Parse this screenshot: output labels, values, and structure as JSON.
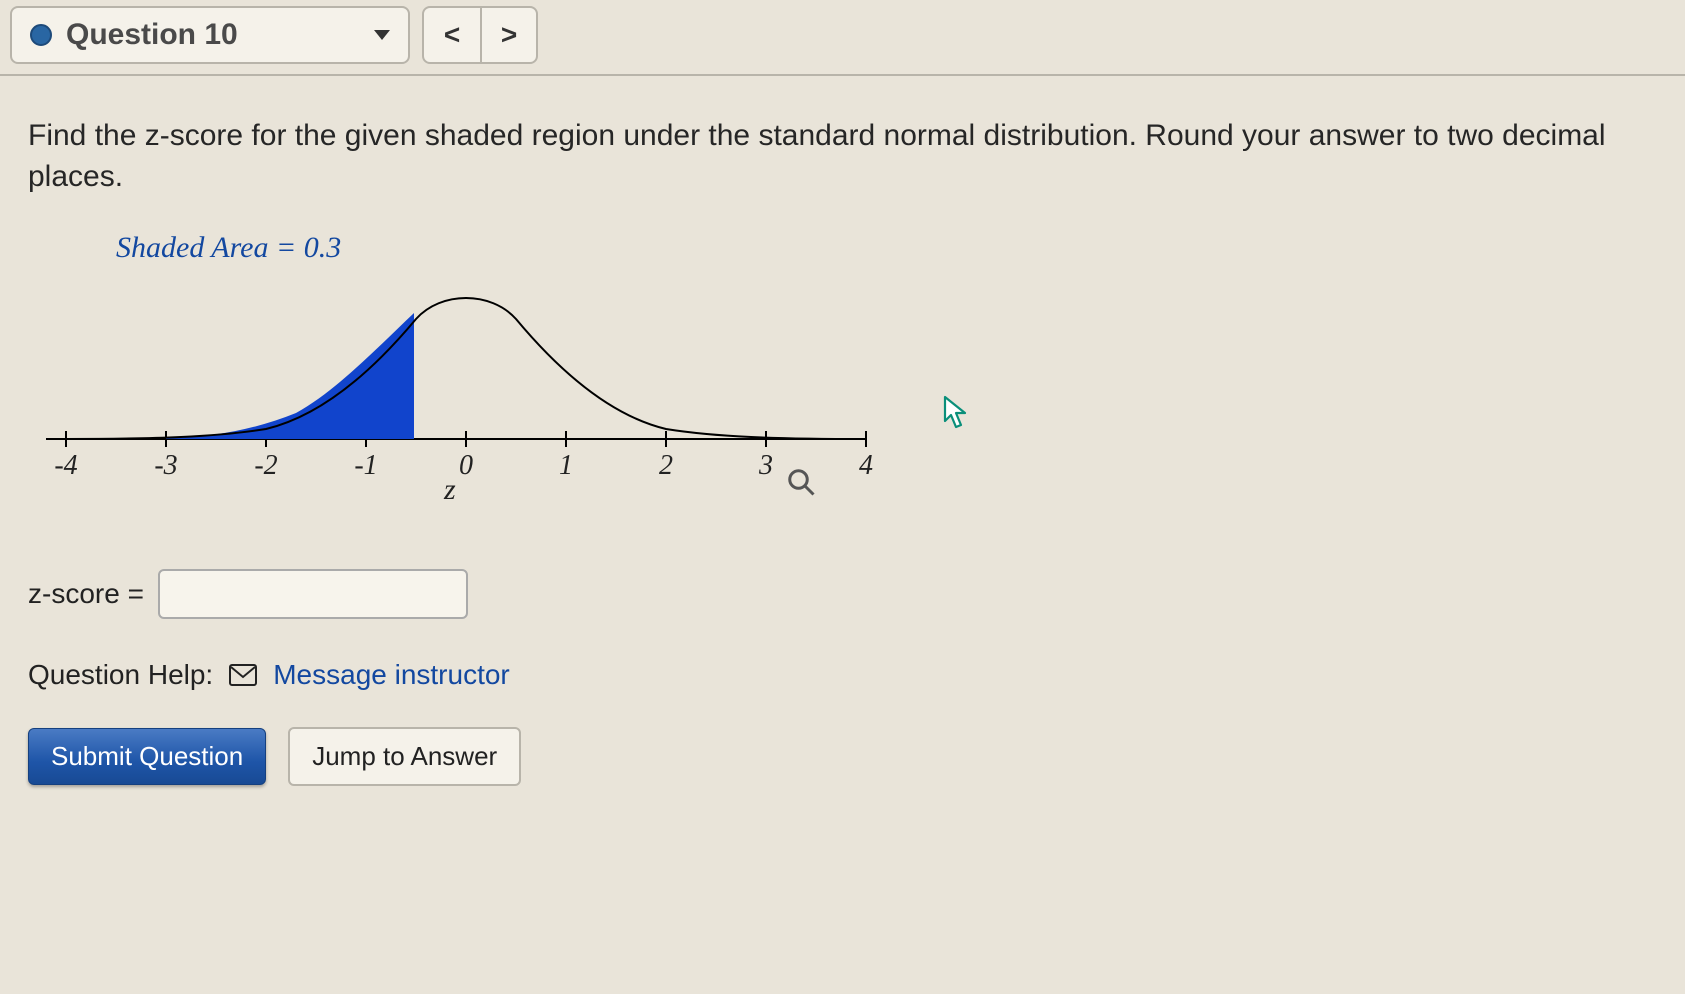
{
  "header": {
    "question_label": "Question 10",
    "prev_symbol": "<",
    "next_symbol": ">"
  },
  "prompt": "Find the z-score for the given shaded region under the standard normal distribution. Round your answer to two decimal places.",
  "chart_data": {
    "type": "area",
    "title": "Shaded Area = 0.3",
    "xlabel": "z",
    "x_ticks": [
      -4,
      -3,
      -2,
      -1,
      0,
      1,
      2,
      3,
      4
    ],
    "xlim": [
      -4,
      4
    ],
    "distribution": "standard_normal",
    "shaded_region": {
      "from": "-inf",
      "to": "z",
      "area": 0.3,
      "approx_z": -0.52
    },
    "shaded_color": "#1144cc"
  },
  "answer": {
    "label": "z-score =",
    "value": ""
  },
  "help": {
    "label": "Question Help:",
    "message_link": "Message instructor"
  },
  "buttons": {
    "submit": "Submit Question",
    "jump": "Jump to Answer"
  }
}
